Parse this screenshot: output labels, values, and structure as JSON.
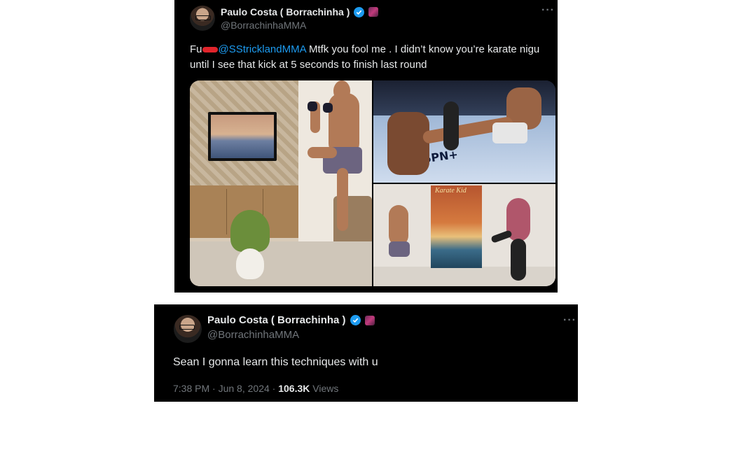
{
  "tweet1": {
    "display_name": "Paulo Costa ( Borrachinha )",
    "handle": "@BorrachinhaMMA",
    "more": "···",
    "text_prefix": "Fu",
    "mention": "@SStricklandMMA",
    "text_body": " Mtfk you fool me . I didn’t know you’re karate nigu until I see that kick at 5 seconds to finish last round",
    "media": {
      "poster_title": "Karate Kid",
      "floor_logo": "ESPN+"
    }
  },
  "tweet2": {
    "display_name": "Paulo Costa ( Borrachinha )",
    "handle": "@BorrachinhaMMA",
    "more": "···",
    "text": "Sean I gonna learn this techniques with u",
    "time": "7:38 PM",
    "separator1": " · ",
    "date": "Jun 8, 2024",
    "separator2": " · ",
    "views_count": "106.3K",
    "views_label": " Views"
  },
  "colors": {
    "background": "#000000",
    "text": "#e7e9ea",
    "secondary": "#71767b",
    "link": "#1d9bf0",
    "verified": "#1d9bf0",
    "censor_mark": "#e0242b"
  },
  "icons": [
    "verified-badge-icon",
    "org-affiliation-icon",
    "more-options-icon"
  ]
}
